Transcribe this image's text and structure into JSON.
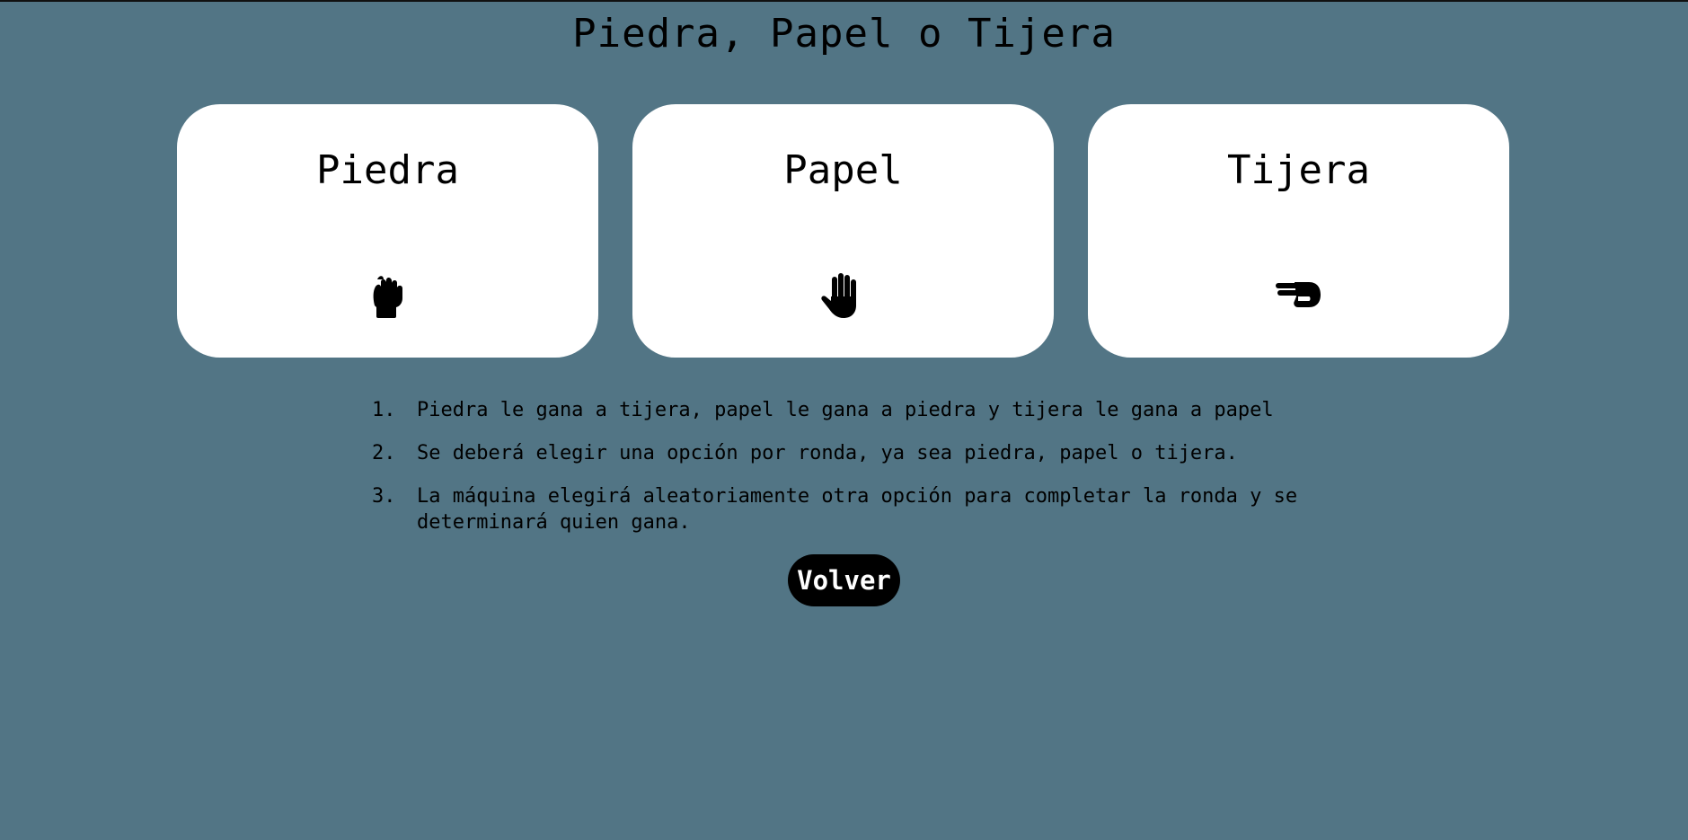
{
  "title": "Piedra, Papel o Tijera",
  "options": [
    {
      "label": "Piedra",
      "icon": "hand-fist-icon"
    },
    {
      "label": "Papel",
      "icon": "hand-open-icon"
    },
    {
      "label": "Tijera",
      "icon": "hand-scissors-icon"
    }
  ],
  "rules": [
    {
      "num": "1.",
      "text": "Piedra le gana a tijera, papel le gana a piedra y tijera le gana a papel"
    },
    {
      "num": "2.",
      "text": "Se deberá elegir una opción por ronda, ya sea piedra, papel o tijera."
    },
    {
      "num": "3.",
      "text": "La máquina elegirá aleatoriamente otra opción para completar la ronda y se determinará quien gana."
    }
  ],
  "back_label": "Volver",
  "colors": {
    "background": "#527585",
    "card": "#ffffff",
    "button": "#000000",
    "button_text": "#ffffff"
  }
}
